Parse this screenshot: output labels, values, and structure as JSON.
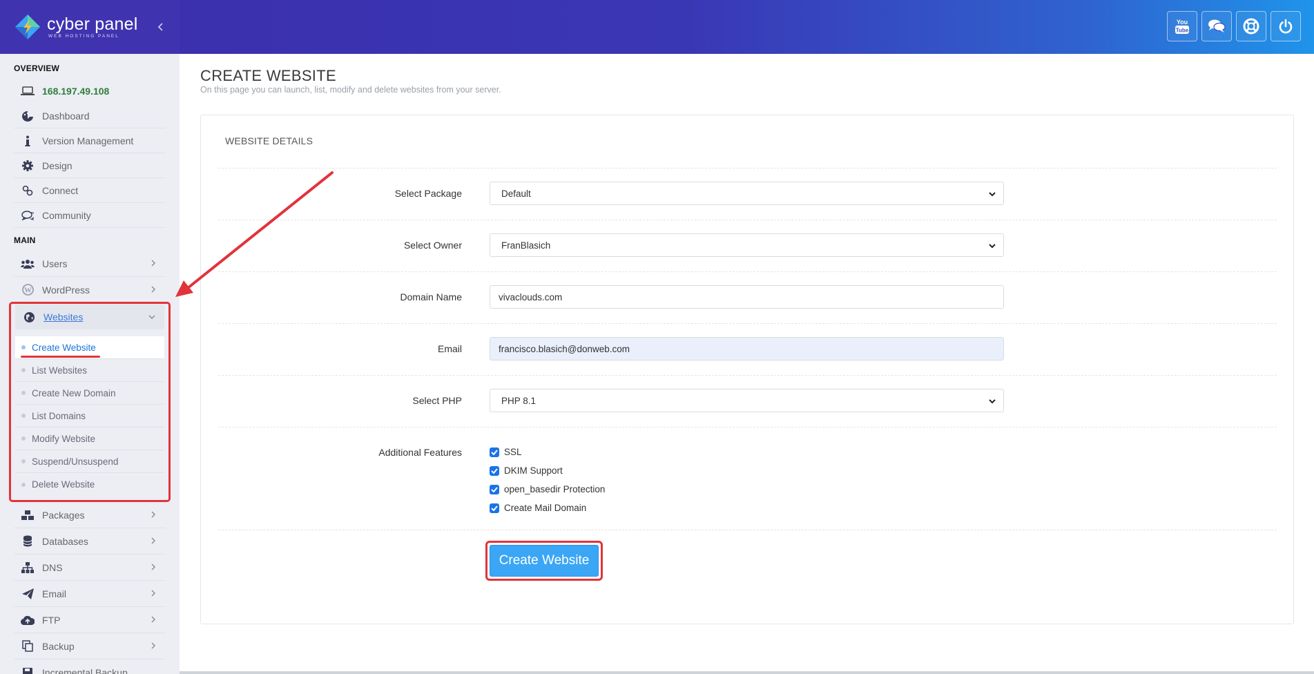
{
  "brand": {
    "title": "cyber panel",
    "subtitle": "WEB HOSTING PANEL"
  },
  "sidebar": {
    "overview_label": "OVERVIEW",
    "ip": "168.197.49.108",
    "overview_items": [
      {
        "label": "Dashboard",
        "icon": "palette-icon"
      },
      {
        "label": "Version Management",
        "icon": "info-icon"
      },
      {
        "label": "Design",
        "icon": "gear-icon"
      },
      {
        "label": "Connect",
        "icon": "link-icon"
      },
      {
        "label": "Community",
        "icon": "comments-icon"
      }
    ],
    "main_label": "MAIN",
    "main_items_top": [
      {
        "label": "Users",
        "icon": "users-icon"
      },
      {
        "label": "WordPress",
        "icon": "wordpress-icon"
      },
      {
        "label": "Websites",
        "icon": "globe-icon"
      }
    ],
    "websites_submenu": [
      "Create Website",
      "List Websites",
      "Create New Domain",
      "List Domains",
      "Modify Website",
      "Suspend/Unsuspend",
      "Delete Website"
    ],
    "main_items_bottom": [
      {
        "label": "Packages",
        "icon": "cubes-icon"
      },
      {
        "label": "Databases",
        "icon": "database-icon"
      },
      {
        "label": "DNS",
        "icon": "sitemap-icon"
      },
      {
        "label": "Email",
        "icon": "paper-plane-icon"
      },
      {
        "label": "FTP",
        "icon": "cloud-upload-icon"
      },
      {
        "label": "Backup",
        "icon": "copy-icon"
      },
      {
        "label": "Incremental Backup",
        "icon": "save-icon"
      }
    ]
  },
  "header": {
    "buttons": [
      "youtube-icon",
      "chat-icon",
      "support-icon",
      "power-icon"
    ]
  },
  "page": {
    "title": "CREATE WEBSITE",
    "description": "On this page you can launch, list, modify and delete websites from your server."
  },
  "form": {
    "section_title": "WEBSITE DETAILS",
    "package_label": "Select Package",
    "package_value": "Default",
    "owner_label": "Select Owner",
    "owner_value": "FranBlasich",
    "domain_label": "Domain Name",
    "domain_value": "vivaclouds.com",
    "email_label": "Email",
    "email_value": "francisco.blasich@donweb.com",
    "php_label": "Select PHP",
    "php_value": "PHP 8.1",
    "features_label": "Additional Features",
    "features": [
      {
        "label": "SSL",
        "checked": true
      },
      {
        "label": "DKIM Support",
        "checked": true
      },
      {
        "label": "open_basedir Protection",
        "checked": true
      },
      {
        "label": "Create Mail Domain",
        "checked": true
      }
    ],
    "submit_label": "Create Website"
  },
  "colors": {
    "accent": "#3aa6f5",
    "header_start": "#3b30ae",
    "header_end": "#1f94ea",
    "annotation": "#e2333a",
    "ip_green": "#2f7e3b"
  }
}
